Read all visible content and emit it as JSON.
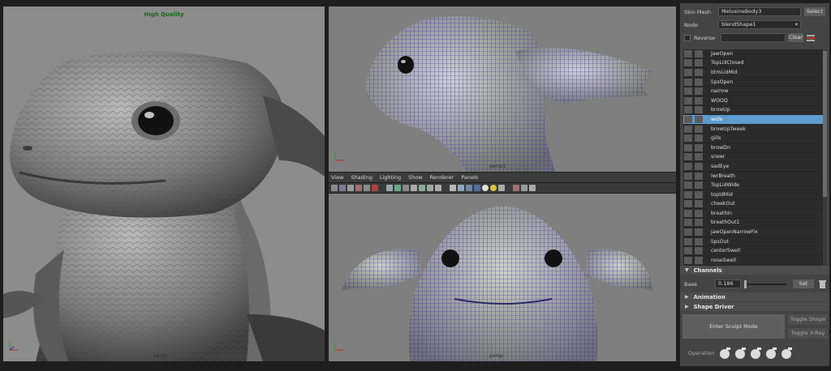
{
  "viewports": {
    "left": {
      "title": "High Quality",
      "camera": "persp"
    },
    "top": {
      "camera": "persp1"
    },
    "bottom": {
      "camera": "persp"
    }
  },
  "menu": [
    "View",
    "Shading",
    "Lighting",
    "Show",
    "Renderer",
    "Panels"
  ],
  "panel": {
    "skin_mesh_label": "Skin Mesh",
    "skin_mesh_value": "MelusineBody3",
    "select_label": "Select",
    "node_label": "Node",
    "node_value": "blendShape1",
    "reverse_label": "Reverse",
    "clear_label": "Clear",
    "shapes": [
      "JawOpen",
      "TopLidClosed",
      "btmLidMid",
      "lipsOpen",
      "narrow",
      "WOOQ",
      "browUp",
      "wide",
      "browUpTweek",
      "gills",
      "browDn",
      "sneer",
      "sadEye",
      "lwrBreath",
      "TopLidWide",
      "topldMid",
      "cheekOut",
      "breathIn",
      "breathOut1",
      "jawOpenNarrowFix",
      "lipsOut",
      "centerSwell",
      "noseSwell"
    ],
    "selected_shape": "wide",
    "channels_label": "Channels",
    "base_label": "Base",
    "base_value": "0.186",
    "set_label": "Set",
    "animation_label": "Animation",
    "shape_driver_label": "Shape Driver",
    "enter_sculpt_label": "Enter Sculpt Mode",
    "toggle_shape_label": "Toggle Shape",
    "toggle_xray_label": "Toggle X-Ray",
    "operation_label": "Operation"
  },
  "colors": {
    "selection": "#5d9bd0",
    "wire": "#2a2aa8",
    "title_green": "#1a6a1a"
  }
}
